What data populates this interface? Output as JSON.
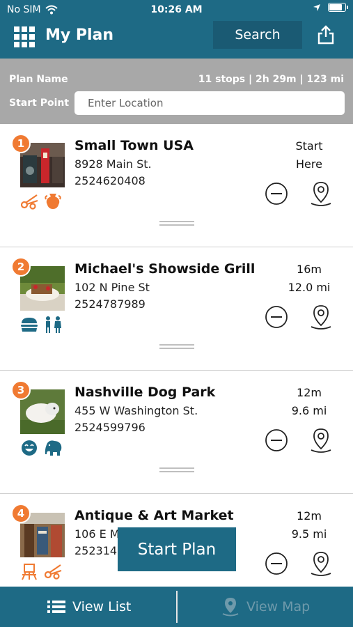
{
  "status_bar": {
    "carrier": "No SIM",
    "time": "10:26 AM"
  },
  "header": {
    "title": "My Plan",
    "search_label": "Search"
  },
  "plan": {
    "name_label": "Plan Name",
    "summary": "11 stops | 2h 29m | 123 mi",
    "start_label": "Start Point",
    "start_placeholder": "Enter Location"
  },
  "stops": [
    {
      "number": "1",
      "name": "Small Town USA",
      "address": "8928 Main St.",
      "phone": "2524620408",
      "time": "Start",
      "distance": "Here",
      "categories": [
        "scissors-icon",
        "vase-icon"
      ]
    },
    {
      "number": "2",
      "name": "Michael's Showside Grill",
      "address": "102 N Pine St",
      "phone": "2524787989",
      "time": "16m",
      "distance": "12.0 mi",
      "categories": [
        "burger-icon",
        "family-icon"
      ]
    },
    {
      "number": "3",
      "name": "Nashville Dog Park",
      "address": "455 W Washington St.",
      "phone": "2524599796",
      "time": "12m",
      "distance": "9.6 mi",
      "categories": [
        "laughing-face-icon",
        "elephant-icon"
      ]
    },
    {
      "number": "4",
      "name": "Antique & Art Market",
      "address": "106 E M",
      "phone": "2523142",
      "time": "12m",
      "distance": "9.5 mi",
      "categories": [
        "easel-icon",
        "scissors-icon"
      ]
    }
  ],
  "start_plan_label": "Start Plan",
  "bottom_tabs": {
    "list_label": "View List",
    "map_label": "View Map"
  },
  "colors": {
    "brand": "#1e6a85",
    "accent": "#f07a32",
    "category_blue": "#1e6a85",
    "plan_bar": "#a8a8a8"
  }
}
